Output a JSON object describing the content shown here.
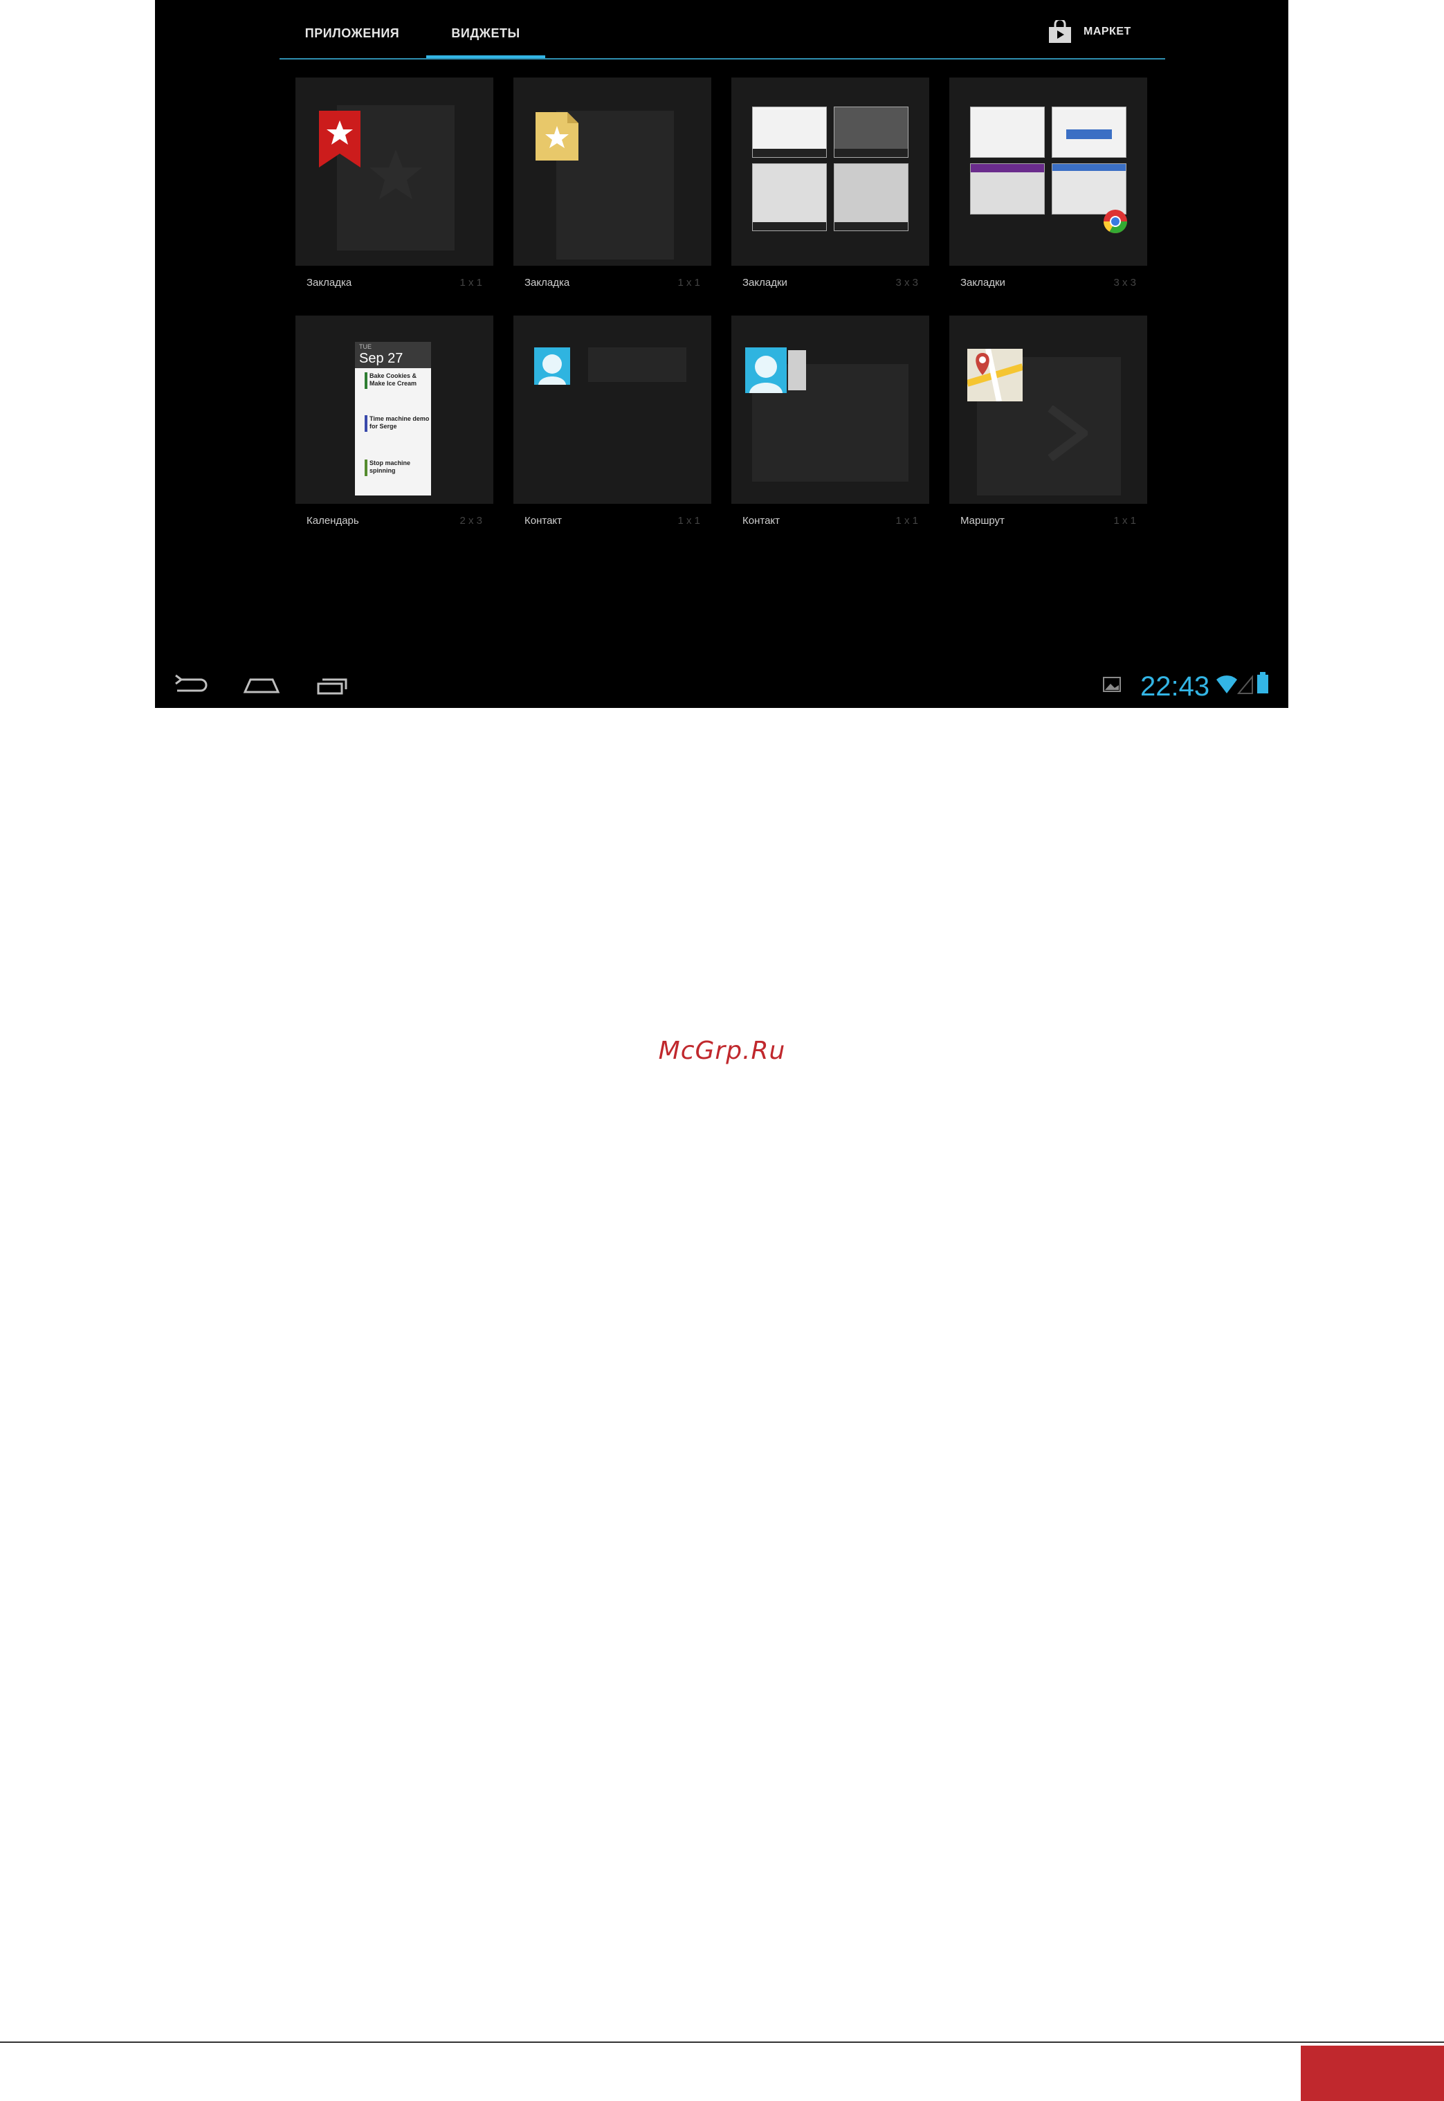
{
  "tabs": {
    "apps": "ПРИЛОЖЕНИЯ",
    "widgets": "ВИДЖЕТЫ"
  },
  "market": {
    "label": "МАРКЕТ",
    "icon": "shopping-bag-icon"
  },
  "widgets": [
    {
      "label": "Закладка",
      "size": "1 x 1",
      "icon": "bookmark-star-icon"
    },
    {
      "label": "Закладка",
      "size": "1 x 1",
      "icon": "bookmark-file-icon"
    },
    {
      "label": "Закладки",
      "size": "3 x 3",
      "icon": "bookmarks-grid-icon"
    },
    {
      "label": "Закладки",
      "size": "3 x 3",
      "icon": "bookmarks-chrome-icon"
    },
    {
      "label": "Календарь",
      "size": "2 x 3",
      "icon": "calendar-icon"
    },
    {
      "label": "Контакт",
      "size": "1 x 1",
      "icon": "contact-icon"
    },
    {
      "label": "Контакт",
      "size": "1 x 1",
      "icon": "contact-card-icon"
    },
    {
      "label": "Маршрут",
      "size": "1 x 1",
      "icon": "maps-directions-icon"
    }
  ],
  "calendar_preview": {
    "day": "TUE",
    "date": "Sep 27",
    "events": [
      {
        "title": "Bake Cookies & Make Ice Cream"
      },
      {
        "title": "Time machine demo for Serge"
      },
      {
        "title": "Stop machine spinning"
      }
    ]
  },
  "status_bar": {
    "time": "22:43"
  },
  "watermark": "McGrp.Ru",
  "colors": {
    "accent": "#33b5e5",
    "brand_red": "#c0282d"
  }
}
